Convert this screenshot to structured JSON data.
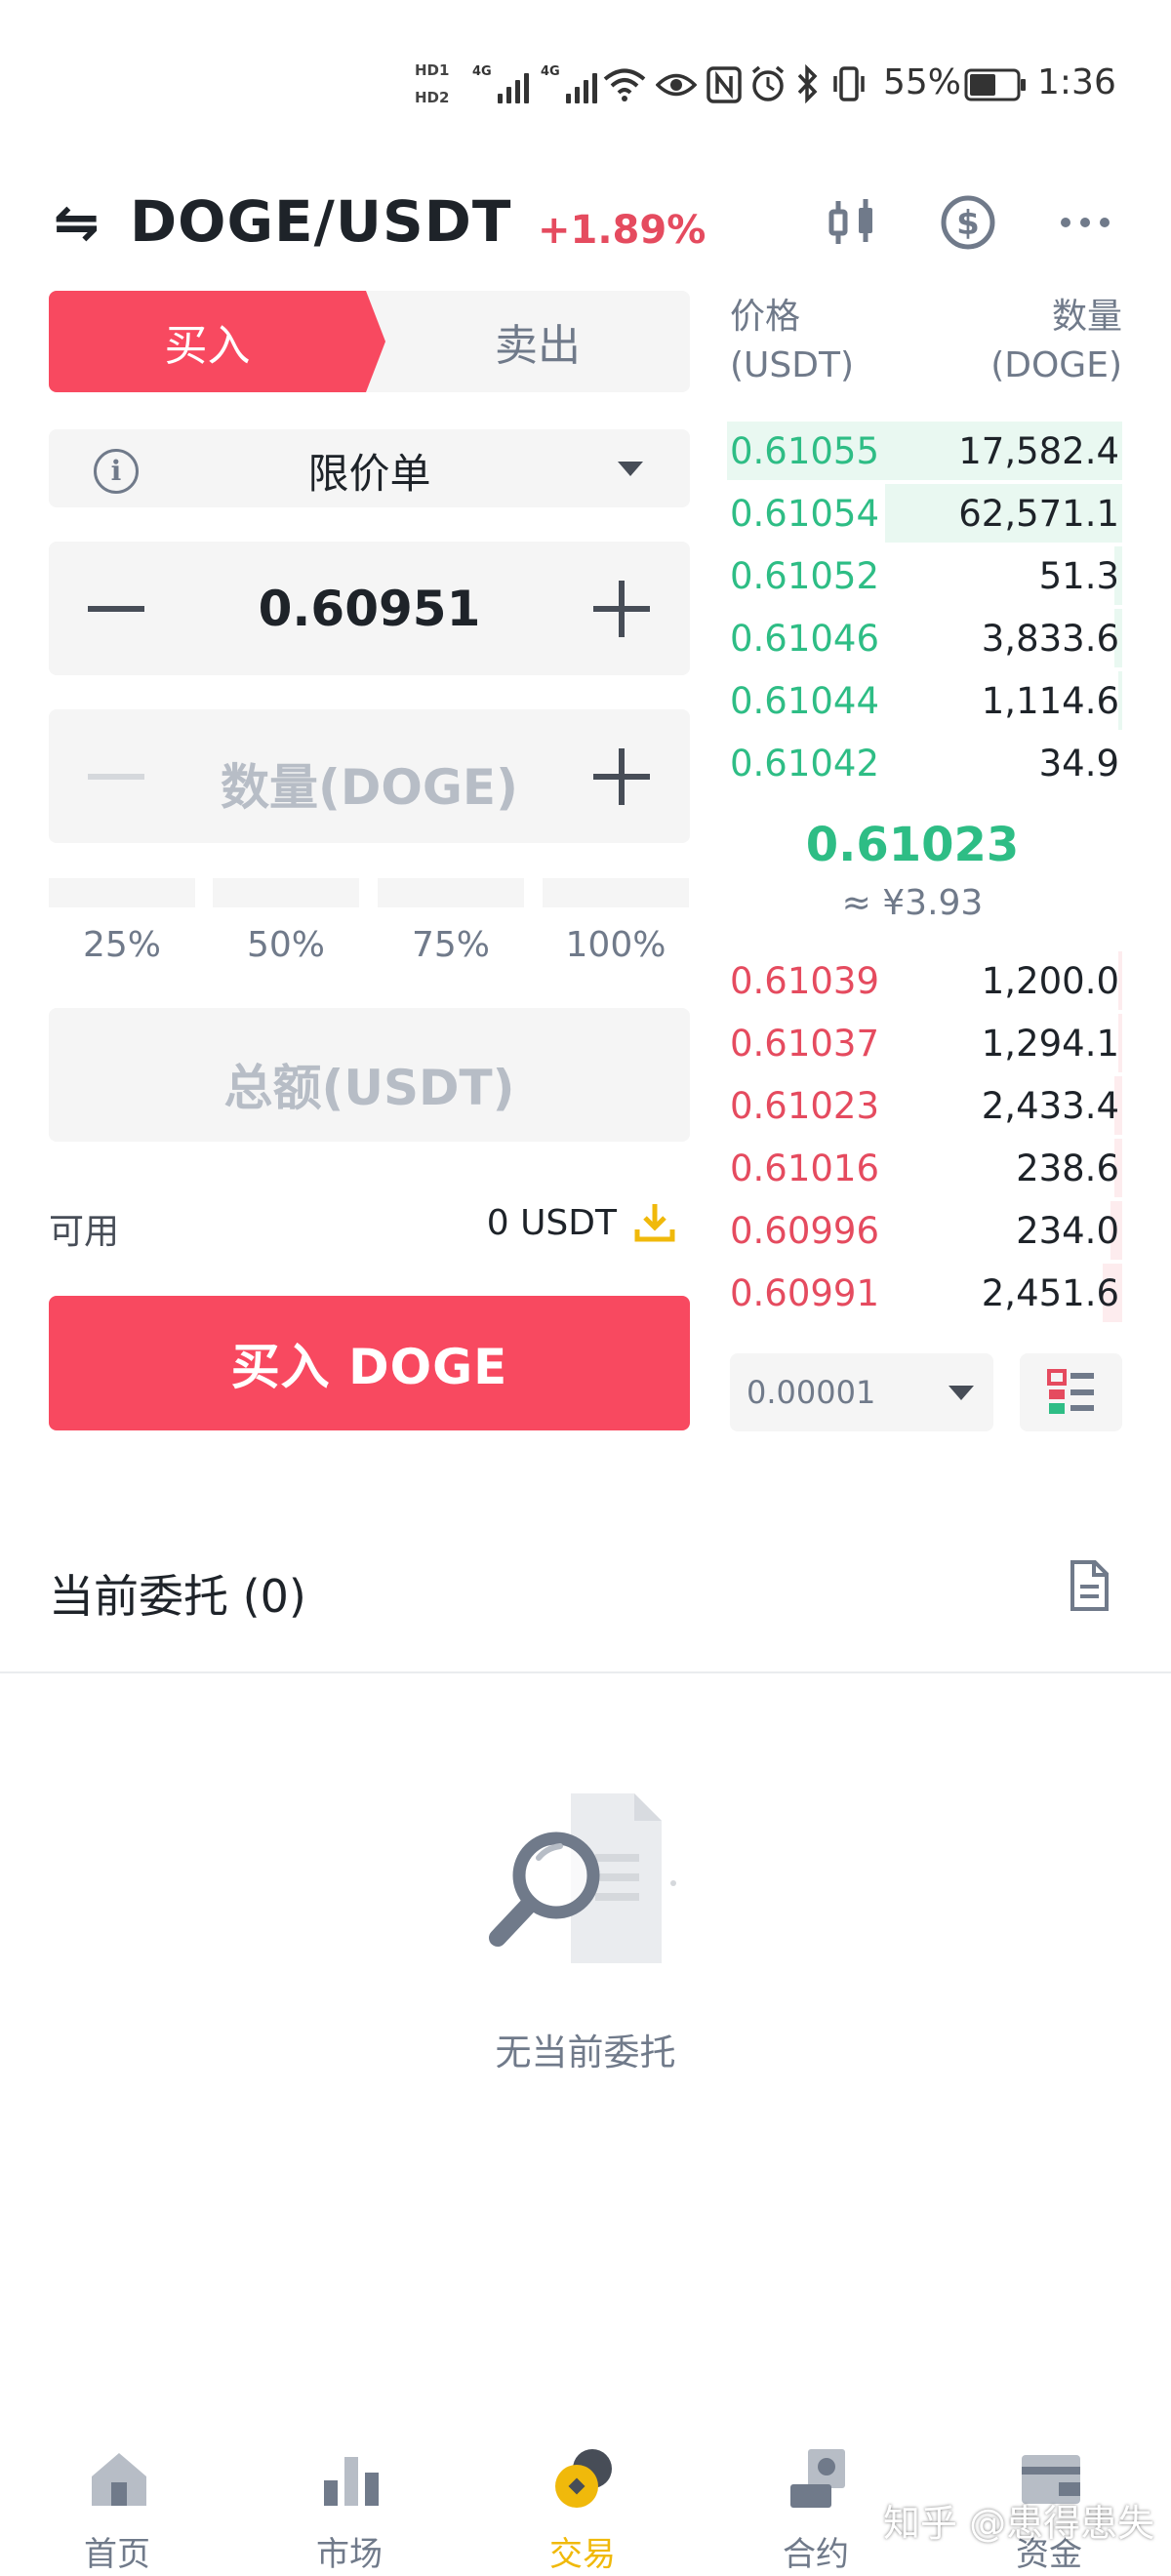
{
  "status_bar": {
    "hd1": "HD1",
    "hd2": "HD2",
    "net1": "4G",
    "net2": "4G",
    "battery_pct": "55%",
    "time": "1:36"
  },
  "header": {
    "pair": "DOGE/USDT",
    "change": "+1.89%",
    "icons": [
      "candlestick-chart-icon",
      "dollar-circle-icon",
      "more-icon"
    ]
  },
  "trade_form": {
    "tabs": {
      "buy": "买入",
      "sell": "卖出"
    },
    "order_type": "限价单",
    "price_value": "0.60951",
    "amount_placeholder": "数量(DOGE)",
    "percent_options": [
      "25%",
      "50%",
      "75%",
      "100%"
    ],
    "total_placeholder": "总额(USDT)",
    "available_label": "可用",
    "available_value": "0 USDT",
    "submit_label": "买入 DOGE"
  },
  "order_book": {
    "header": {
      "price_label": "价格",
      "price_unit": "(USDT)",
      "qty_label": "数量",
      "qty_unit": "(DOGE)"
    },
    "bids_top": [
      {
        "price": "0.61055",
        "qty": "17,582.4",
        "depth": 1.0
      },
      {
        "price": "0.61054",
        "qty": "62,571.1",
        "depth": 0.6
      },
      {
        "price": "0.61052",
        "qty": "51.3",
        "depth": 0.02
      },
      {
        "price": "0.61046",
        "qty": "3,833.6",
        "depth": 0.02
      },
      {
        "price": "0.61044",
        "qty": "1,114.6",
        "depth": 0.01
      },
      {
        "price": "0.61042",
        "qty": "34.9",
        "depth": 0.0
      }
    ],
    "mid_price": "0.61023",
    "mid_fiat": "≈ ¥3.93",
    "asks_bottom": [
      {
        "price": "0.61039",
        "qty": "1,200.0",
        "depth": 0.01
      },
      {
        "price": "0.61037",
        "qty": "1,294.1",
        "depth": 0.01
      },
      {
        "price": "0.61023",
        "qty": "2,433.4",
        "depth": 0.02
      },
      {
        "price": "0.61016",
        "qty": "238.6",
        "depth": 0.02
      },
      {
        "price": "0.60996",
        "qty": "234.0",
        "depth": 0.03
      },
      {
        "price": "0.60991",
        "qty": "2,451.6",
        "depth": 0.05
      }
    ],
    "precision": "0.00001"
  },
  "current_orders": {
    "title": "当前委托 (0)",
    "empty_text": "无当前委托"
  },
  "bottom_nav": [
    {
      "label": "首页",
      "icon": "home-icon",
      "active": false
    },
    {
      "label": "市场",
      "icon": "market-bars-icon",
      "active": false
    },
    {
      "label": "交易",
      "icon": "trade-coins-icon",
      "active": true
    },
    {
      "label": "合约",
      "icon": "futures-icon",
      "active": false
    },
    {
      "label": "资金",
      "icon": "wallet-icon",
      "active": false
    }
  ],
  "watermark": "知乎 @患得患失",
  "colors": {
    "buy_red": "#f84960",
    "price_green": "#2ebd85",
    "price_red": "#e54b5f",
    "accent_yellow": "#f0b90b"
  }
}
